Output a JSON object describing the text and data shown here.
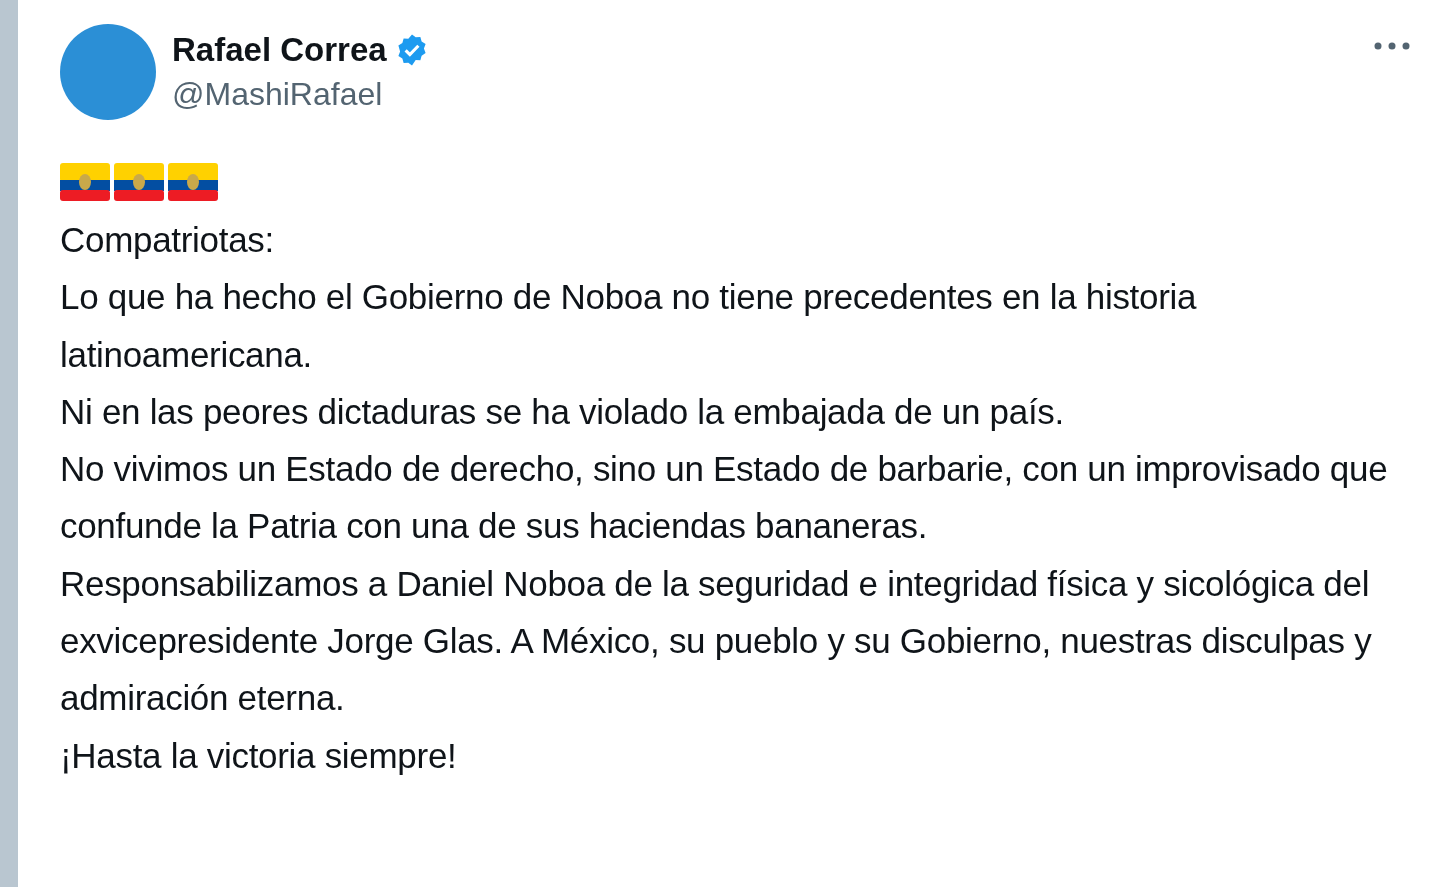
{
  "author": {
    "name": "Rafael Correa",
    "verified": true,
    "handle": "@MashiRafael"
  },
  "post": {
    "paragraphs": [
      "Compatriotas:",
      "Lo que ha hecho el Gobierno de Noboa no tiene precedentes en la historia latinoamericana.",
      "Ni en las peores dictaduras se ha violado la embajada de un país.",
      "No vivimos un Estado de derecho, sino un Estado de barbarie, con un improvisado que confunde la Patria con una de sus haciendas bananeras.",
      "Responsabilizamos a Daniel Noboa de la seguridad e integridad física y sicológica del exvicepresidente Jorge Glas. A México, su pueblo y su Gobierno, nuestras disculpas y admiración eterna.",
      "¡Hasta la victoria siempre!"
    ]
  }
}
